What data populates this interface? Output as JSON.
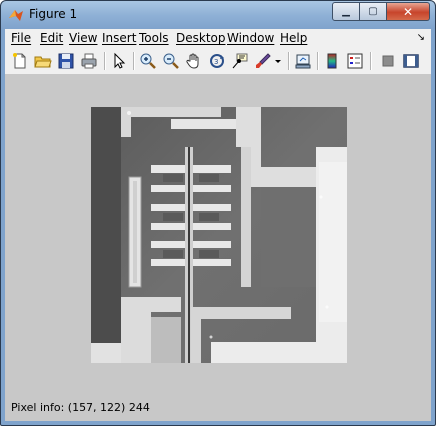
{
  "window": {
    "title": "Figure 1"
  },
  "menu": {
    "items": [
      "File",
      "Edit",
      "View",
      "Insert",
      "Tools",
      "Desktop",
      "Window",
      "Help"
    ]
  },
  "toolbar": {
    "icons": [
      "new-figure-icon",
      "open-file-icon",
      "save-icon",
      "print-icon",
      "pointer-icon",
      "zoom-in-icon",
      "zoom-out-icon",
      "pan-hand-icon",
      "rotate-3d-icon",
      "data-cursor-icon",
      "brush-icon",
      "brush-dropdown-icon",
      "link-plot-icon",
      "colorbar-icon",
      "legend-icon",
      "hide-plot-tools-icon",
      "show-plot-tools-icon"
    ]
  },
  "status": {
    "pixel_info": "Pixel info: (157, 122)  244"
  },
  "colors": {
    "figure_bg": "#c8c8c8",
    "titlebar": "#8fb1d6",
    "close": "#c7442b"
  }
}
